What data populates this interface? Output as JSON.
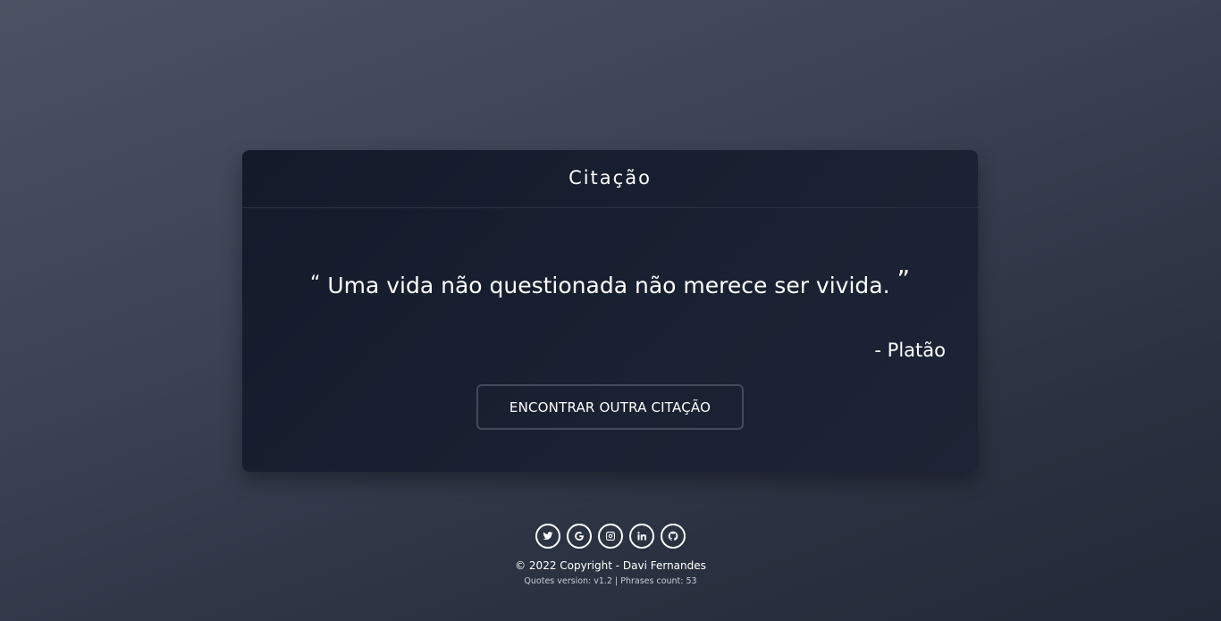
{
  "card": {
    "title": "Citação",
    "quote_open": "“",
    "quote": "Uma vida não questionada não merece ser vivida.",
    "quote_close": "”",
    "author": "- Platão",
    "button_label": "ENCONTRAR OUTRA CITAÇÃO"
  },
  "footer": {
    "socials": [
      {
        "name": "twitter-icon"
      },
      {
        "name": "google-icon"
      },
      {
        "name": "instagram-icon"
      },
      {
        "name": "linkedin-icon"
      },
      {
        "name": "github-icon"
      }
    ],
    "copyright": "© 2022 Copyright - Davi Fernandes",
    "version_info": "Quotes version: v1.2 | Phrases count: 53"
  },
  "colors": {
    "background_top": "#4a5263",
    "background_bottom": "#222938",
    "card_bg": "#171e2e",
    "text": "#ffffff",
    "button_border": "#434b5b"
  }
}
